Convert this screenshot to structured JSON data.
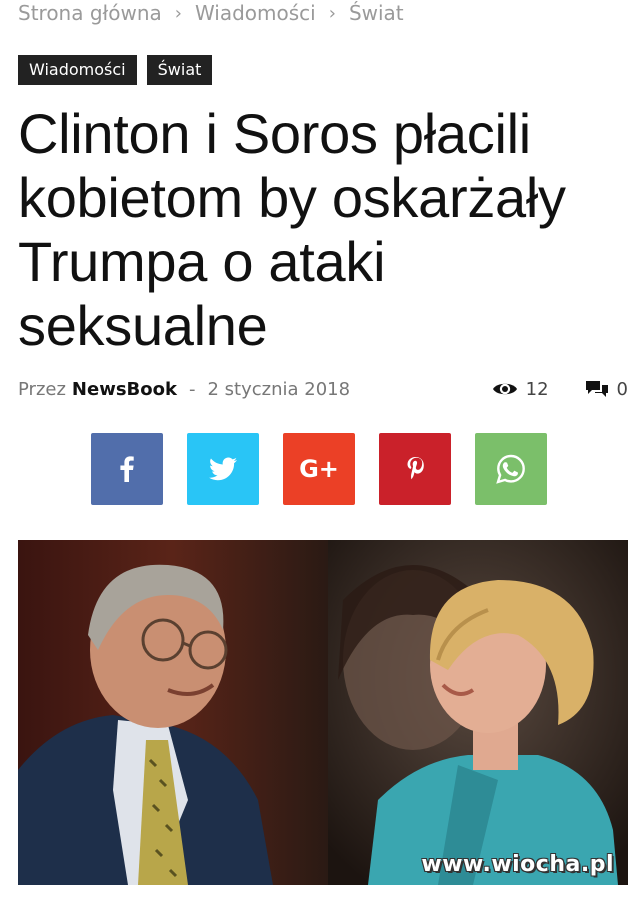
{
  "breadcrumb": {
    "items": [
      "Strona główna",
      "Wiadomości",
      "Świat"
    ],
    "separator": "›"
  },
  "tags": [
    "Wiadomości",
    "Świat"
  ],
  "article": {
    "title": "Clinton i Soros płacili kobietom by oskarżały Trumpa o ataki seksualne",
    "by_label": "Przez",
    "author": "NewsBook",
    "dash": "-",
    "date": "2 stycznia 2018",
    "views": "12",
    "comments": "0"
  },
  "share": {
    "icons": [
      "facebook-icon",
      "twitter-icon",
      "google-plus-icon",
      "pinterest-icon",
      "whatsapp-icon"
    ],
    "colors": {
      "facebook": "#516eab",
      "twitter": "#29c5f6",
      "google_plus": "#eb4026",
      "pinterest": "#ca212a",
      "whatsapp": "#7bbf6a"
    },
    "google_plus_text": "G+"
  },
  "photo": {
    "watermark": "www.wiocha.pl"
  }
}
